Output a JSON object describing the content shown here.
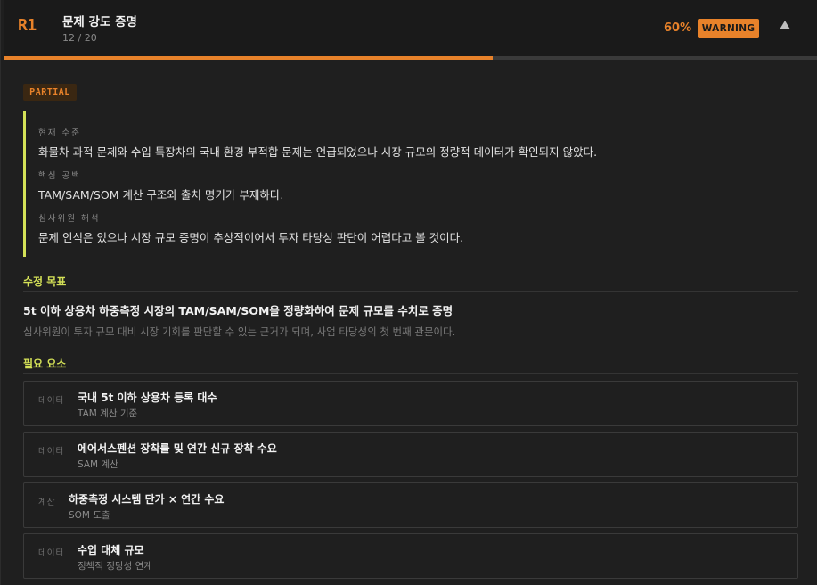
{
  "header": {
    "round": "R1",
    "title": "문제 강도 증명",
    "subtitle": "12 / 20",
    "score": "60%",
    "badge": "WARNING",
    "progress": 0.6,
    "accent_color": "#e8822a"
  },
  "status": "PARTIAL",
  "review": {
    "items": [
      {
        "label": "현재 수준",
        "text": "화물차 과적 문제와 수입 특장차의 국내 환경 부적합 문제는 언급되었으나 시장 규모의 정량적 데이터가 확인되지 않았다."
      },
      {
        "label": "핵심 공백",
        "text": "TAM/SAM/SOM 계산 구조와 출처 명기가 부재하다."
      },
      {
        "label": "심사위원 해석",
        "text": "문제 인식은 있으나 시장 규모 증명이 추상적이어서 투자 타당성 판단이 어렵다고 볼 것이다."
      }
    ],
    "border_color": "#d4e157"
  },
  "goal": {
    "section_title": "수정 목표",
    "main": "5t 이하 상용차 하중측정 시장의 TAM/SAM/SOM을 정량화하여 문제 규모를 수치로 증명",
    "desc": "심사위원이 투자 규모 대비 시장 기회를 판단할 수 있는 근거가 되며, 사업 타당성의 첫 번째 관문이다."
  },
  "requirements": {
    "section_title": "필요 요소",
    "items": [
      {
        "type": "데이터",
        "name": "국내 5t 이하 상용차 등록 대수",
        "sub": "TAM 계산 기준"
      },
      {
        "type": "데이터",
        "name": "에어서스펜션 장착률 및 연간 신규 장착 수요",
        "sub": "SAM 계산"
      },
      {
        "type": "계산",
        "name": "하중측정 시스템 단가 × 연간 수요",
        "sub": "SOM 도출"
      },
      {
        "type": "데이터",
        "name": "수입 대체 규모",
        "sub": "정책적 정당성 연계"
      }
    ]
  }
}
